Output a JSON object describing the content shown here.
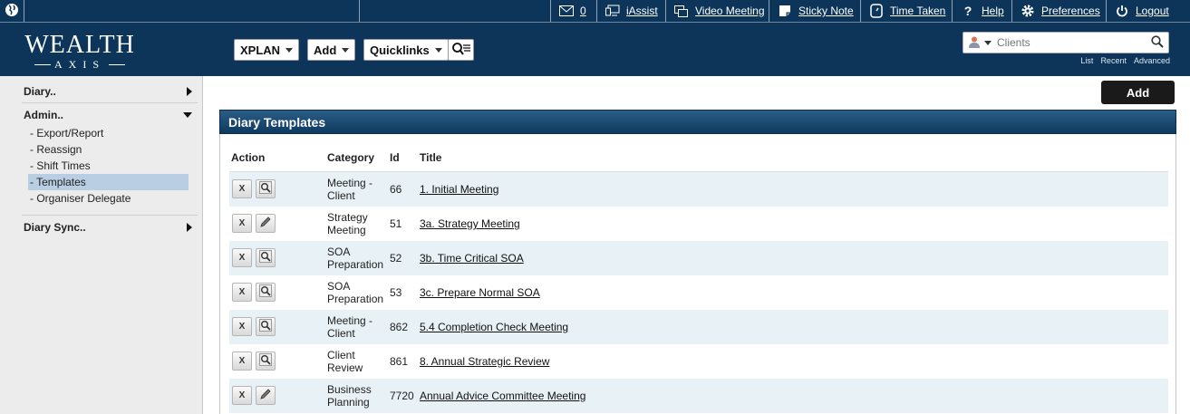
{
  "topbar": {
    "messages_count": "0",
    "iassist": "iAssist",
    "video_meeting": "Video Meeting",
    "sticky_note": "Sticky Note",
    "time_taken": "Time Taken",
    "help_symbol": "?",
    "help": "Help",
    "preferences": "Preferences",
    "logout": "Logout"
  },
  "header": {
    "logo_top": "WEALTH",
    "logo_bottom": "AXIS",
    "menus": [
      "XPLAN",
      "Add",
      "Quicklinks"
    ],
    "search_placeholder": "Clients",
    "search_links": [
      "List",
      "Recent",
      "Advanced"
    ]
  },
  "sidebar": {
    "diary": "Diary..",
    "admin": "Admin..",
    "admin_items": [
      "- Export/Report",
      "- Reassign",
      "- Shift Times",
      "- Templates",
      "- Organiser Delegate"
    ],
    "selected_index": 3,
    "diary_sync": "Diary Sync.."
  },
  "main": {
    "add_button": "Add",
    "panel_title": "Diary Templates",
    "columns": {
      "action": "Action",
      "category": "Category",
      "id": "Id",
      "title": "Title"
    },
    "delete_label": "X",
    "rows": [
      {
        "category": [
          "Meeting -",
          "Client"
        ],
        "id": "66",
        "title": "1. Initial Meeting",
        "action_icon": "magnifier-icon"
      },
      {
        "category": [
          "Strategy",
          "Meeting"
        ],
        "id": "51",
        "title": "3a. Strategy Meeting",
        "action_icon": "pencil-icon"
      },
      {
        "category": [
          "SOA",
          "Preparation"
        ],
        "id": "52",
        "title": "3b. Time Critical SOA",
        "action_icon": "magnifier-icon"
      },
      {
        "category": [
          "SOA",
          "Preparation"
        ],
        "id": "53",
        "title": "3c. Prepare Normal SOA",
        "action_icon": "magnifier-icon"
      },
      {
        "category": [
          "Meeting -",
          "Client"
        ],
        "id": "862",
        "title": "5.4 Completion Check Meeting",
        "action_icon": "magnifier-icon"
      },
      {
        "category": [
          "Client",
          "Review"
        ],
        "id": "861",
        "title": "8. Annual Strategic Review",
        "action_icon": "magnifier-icon"
      },
      {
        "category": [
          "Business",
          "Planning"
        ],
        "id": "7720",
        "title": "Annual Advice Committee Meeting",
        "action_icon": "pencil-icon"
      }
    ]
  },
  "colors": {
    "navy": "#0d3559",
    "row_alt": "#e7f1f6",
    "selected": "#b9cde3"
  }
}
